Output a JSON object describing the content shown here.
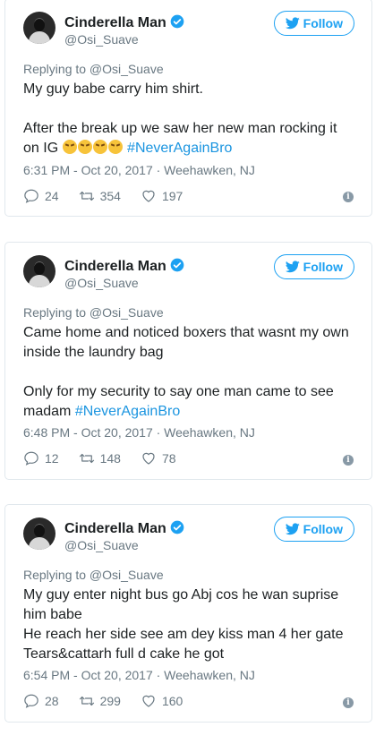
{
  "accent_color": "#1da1f2",
  "tweets": [
    {
      "name": "Cinderella Man",
      "handle": "@Osi_Suave",
      "follow_label": "Follow",
      "replying_to": "Replying to @Osi_Suave",
      "lines": [
        "My guy babe carry him shirt.",
        "",
        "After the break up we saw her new man rocking it on IG"
      ],
      "hashtag": "#NeverAgainBro",
      "emoji": [
        "persevering-face",
        "persevering-face",
        "persevering-face",
        "persevering-face"
      ],
      "timestamp": "6:31 PM - Oct 20, 2017 · Weehawken, NJ",
      "replies": "24",
      "retweets": "354",
      "likes": "197"
    },
    {
      "name": "Cinderella Man",
      "handle": "@Osi_Suave",
      "follow_label": "Follow",
      "replying_to": "Replying to @Osi_Suave",
      "lines": [
        "Came home and noticed boxers that wasnt my own inside the laundry bag",
        "",
        "Only for my security to say one man came to see madam"
      ],
      "hashtag": "#NeverAgainBro",
      "timestamp": "6:48 PM - Oct 20, 2017 · Weehawken, NJ",
      "replies": "12",
      "retweets": "148",
      "likes": "78"
    },
    {
      "name": "Cinderella Man",
      "handle": "@Osi_Suave",
      "follow_label": "Follow",
      "replying_to": "Replying to @Osi_Suave",
      "lines": [
        "My guy enter night bus go Abj cos he wan suprise him babe",
        "He reach her side see am dey kiss man 4 her gate",
        "Tears&cattarh full d cake he got"
      ],
      "timestamp": "6:54 PM - Oct 20, 2017 · Weehawken, NJ",
      "replies": "28",
      "retweets": "299",
      "likes": "160"
    }
  ]
}
